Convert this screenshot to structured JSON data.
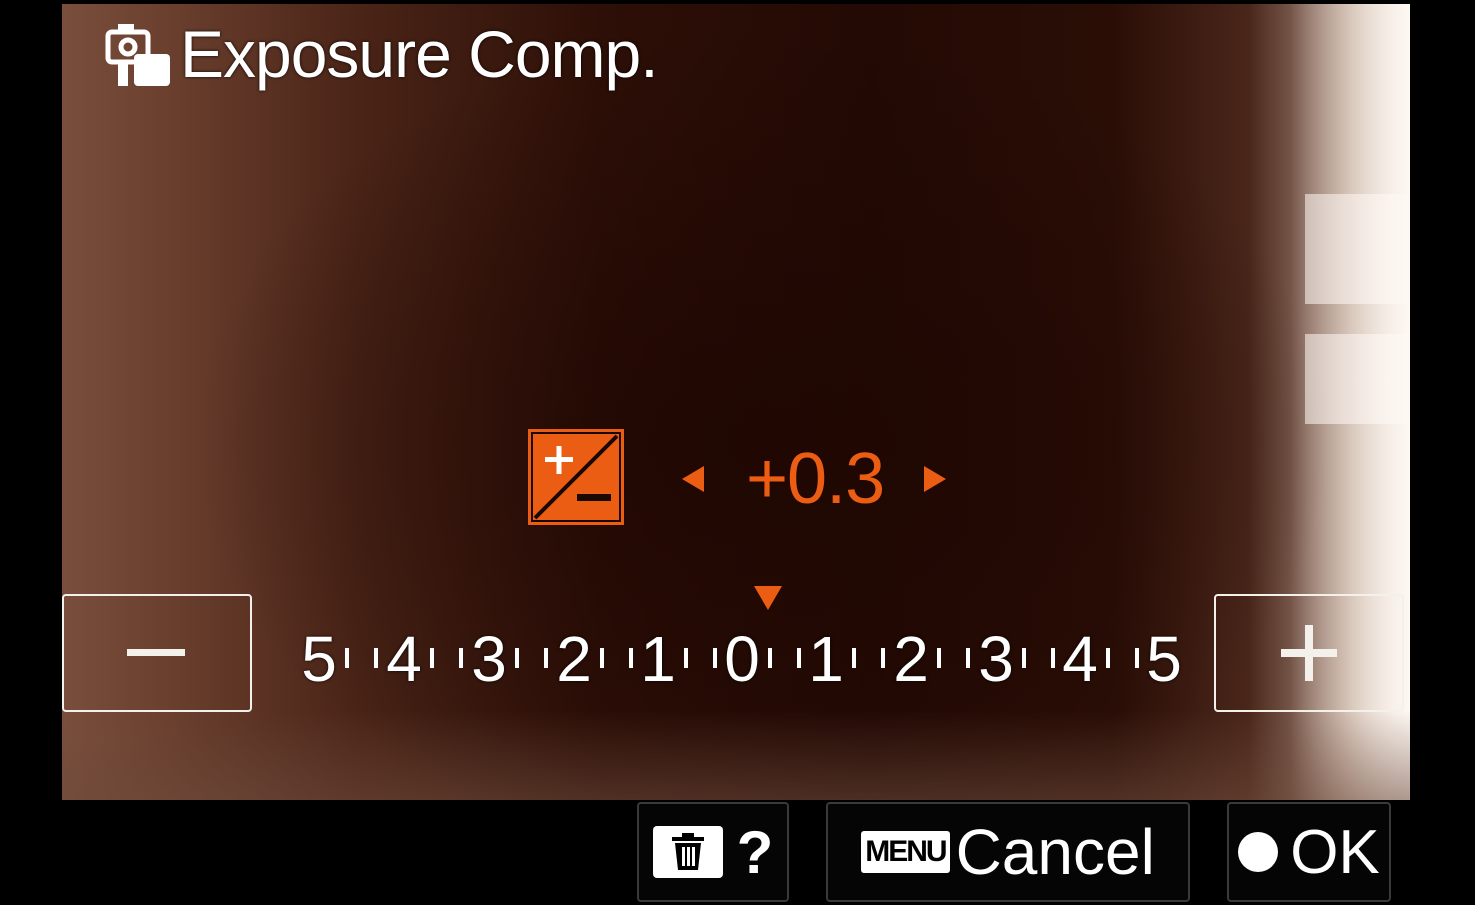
{
  "header": {
    "title": "Exposure Comp.",
    "icon": "camera-settings-icon"
  },
  "exposure": {
    "icon": "exposure-compensation-icon",
    "value": "+0.3",
    "accent_color": "#ec5d14"
  },
  "scale": {
    "labels": [
      "5",
      "4",
      "3",
      "2",
      "1",
      "0",
      "1",
      "2",
      "3",
      "4",
      "5"
    ],
    "decrease_icon": "minus-icon",
    "increase_icon": "plus-icon"
  },
  "softkeys": {
    "help": {
      "icon": "trash-icon",
      "label": "?"
    },
    "cancel": {
      "badge": "MENU",
      "label": "Cancel"
    },
    "ok": {
      "icon": "center-button-dot-icon",
      "label": "OK"
    }
  }
}
